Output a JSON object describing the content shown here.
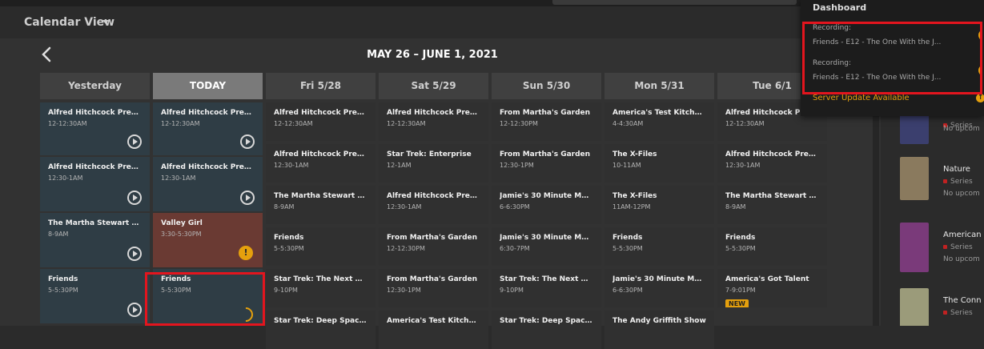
{
  "header": {
    "view_title": "Calendar View"
  },
  "calendar": {
    "range_label": "MAY 26 – JUNE 1, 2021",
    "days": [
      "Yesterday",
      "TODAY",
      "Fri 5/28",
      "Sat 5/29",
      "Sun 5/30",
      "Mon 5/31",
      "Tue 6/1"
    ],
    "columns": [
      [
        {
          "title": "Alfred Hitchcock Presen...",
          "time": "12-12:30AM"
        },
        {
          "title": "Alfred Hitchcock Presen...",
          "time": "12:30-1AM"
        },
        {
          "title": "The Martha Stewart Sh...",
          "time": "8-9AM"
        },
        {
          "title": "Friends",
          "time": "5-5:30PM"
        }
      ],
      [
        {
          "title": "Alfred Hitchcock Presen...",
          "time": "12-12:30AM"
        },
        {
          "title": "Alfred Hitchcock Presen...",
          "time": "12:30-1AM"
        },
        {
          "title": "Valley Girl",
          "time": "3:30-5:30PM"
        },
        {
          "title": "Friends",
          "time": "5-5:30PM"
        }
      ],
      [
        {
          "title": "Alfred Hitchcock Presen...",
          "time": "12-12:30AM"
        },
        {
          "title": "Alfred Hitchcock Presen...",
          "time": "12:30-1AM"
        },
        {
          "title": "The Martha Stewart Sh...",
          "time": "8-9AM"
        },
        {
          "title": "Friends",
          "time": "5-5:30PM"
        },
        {
          "title": "Star Trek: The Next Gen...",
          "time": "9-10PM"
        },
        {
          "title": "Star Trek: Deep Space N...",
          "time": ""
        }
      ],
      [
        {
          "title": "Alfred Hitchcock Presen...",
          "time": "12-12:30AM"
        },
        {
          "title": "Star Trek: Enterprise",
          "time": "12-1AM"
        },
        {
          "title": "Alfred Hitchcock Presen...",
          "time": "12:30-1AM"
        },
        {
          "title": "From Martha's Garden",
          "time": "12-12:30PM"
        },
        {
          "title": "From Martha's Garden",
          "time": "12:30-1PM"
        },
        {
          "title": "America's Test Kitchen ...",
          "time": ""
        }
      ],
      [
        {
          "title": "From Martha's Garden",
          "time": "12-12:30PM"
        },
        {
          "title": "From Martha's Garden",
          "time": "12:30-1PM"
        },
        {
          "title": "Jamie's 30 Minute Meals",
          "time": "6-6:30PM"
        },
        {
          "title": "Jamie's 30 Minute Meals",
          "time": "6:30-7PM"
        },
        {
          "title": "Star Trek: The Next Gen...",
          "time": "9-10PM"
        },
        {
          "title": "Star Trek: Deep Space N...",
          "time": ""
        }
      ],
      [
        {
          "title": "America's Test Kitchen ...",
          "time": "4-4:30AM"
        },
        {
          "title": "The X-Files",
          "time": "10-11AM"
        },
        {
          "title": "The X-Files",
          "time": "11AM-12PM"
        },
        {
          "title": "Friends",
          "time": "5-5:30PM"
        },
        {
          "title": "Jamie's 30 Minute Meals",
          "time": "6-6:30PM"
        },
        {
          "title": "The Andy Griffith Show",
          "time": ""
        }
      ],
      [
        {
          "title": "Alfred Hitchcock Presen...",
          "time": "12-12:30AM"
        },
        {
          "title": "Alfred Hitchcock Presen...",
          "time": "12:30-1AM"
        },
        {
          "title": "The Martha Stewart Sh...",
          "time": "8-9AM"
        },
        {
          "title": "Friends",
          "time": "5-5:30PM"
        },
        {
          "title": "America's Got Talent",
          "time": "7-9:01PM",
          "badge": "NEW"
        }
      ]
    ]
  },
  "dropdown": {
    "title": "Dashboard",
    "recordings": [
      {
        "label": "Recording:",
        "item": "Friends - E12 - The One With the J..."
      },
      {
        "label": "Recording:",
        "item": "Friends - E12 - The One With the J..."
      }
    ],
    "update": "Server Update Available"
  },
  "right_panel": [
    {
      "title": "",
      "type": "Series",
      "sub": "No upcom"
    },
    {
      "title": "Nature",
      "type": "Series",
      "sub": "No upcom"
    },
    {
      "title": "American",
      "type": "Series",
      "sub": "No upcom"
    },
    {
      "title": "The Conn",
      "type": "Series",
      "sub": ""
    }
  ]
}
